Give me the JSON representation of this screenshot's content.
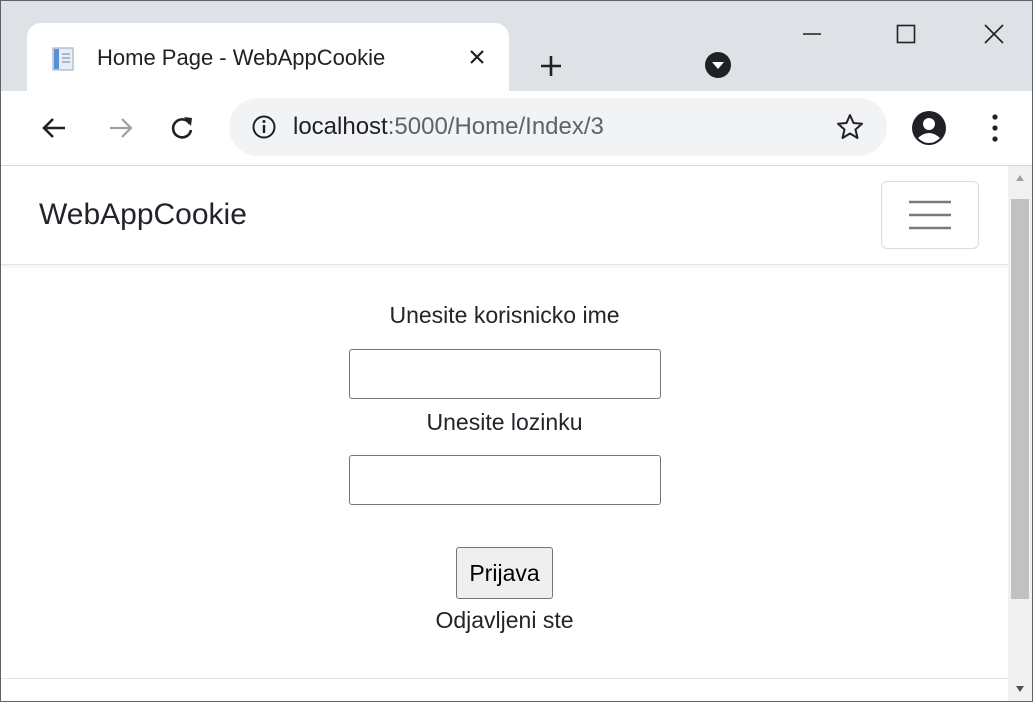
{
  "browser": {
    "tab_title": "Home Page - WebAppCookie",
    "url_host": "localhost",
    "url_path": ":5000/Home/Index/3"
  },
  "icons": {
    "favicon": "page-icon",
    "tab_close": "close-icon",
    "new_tab": "plus-icon",
    "tab_search": "chevron-down-icon",
    "back": "arrow-left-icon",
    "forward": "arrow-right-icon",
    "reload": "reload-icon",
    "site_info": "info-icon",
    "bookmark": "star-icon",
    "profile": "account-icon",
    "menu": "more-vert-icon",
    "nav_toggle": "hamburger-icon"
  },
  "page": {
    "brand": "WebAppCookie",
    "username_label": "Unesite korisnicko ime",
    "username_value": "",
    "password_label": "Unesite lozinku",
    "password_value": "",
    "login_button": "Prijava",
    "status_text": "Odjavljeni ste"
  }
}
